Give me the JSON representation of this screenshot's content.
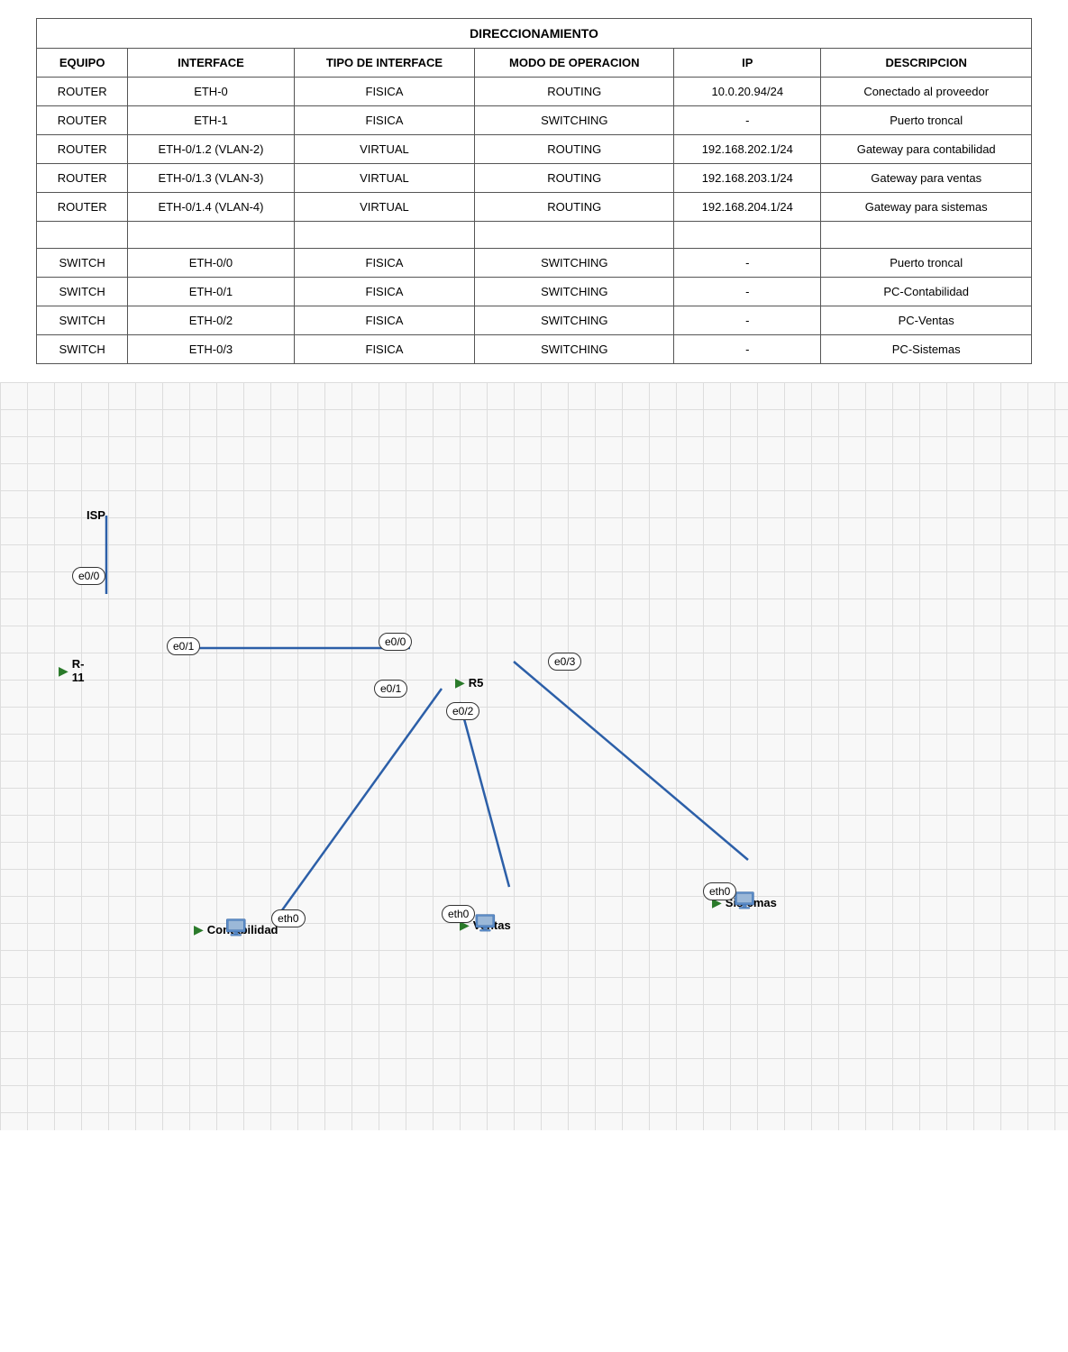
{
  "table": {
    "title": "DIRECCIONAMIENTO",
    "headers": [
      "EQUIPO",
      "INTERFACE",
      "TIPO DE INTERFACE",
      "MODO DE OPERACION",
      "IP",
      "DESCRIPCION"
    ],
    "rows": [
      [
        "ROUTER",
        "ETH-0",
        "FISICA",
        "ROUTING",
        "10.0.20.94/24",
        "Conectado al proveedor"
      ],
      [
        "ROUTER",
        "ETH-1",
        "FISICA",
        "SWITCHING",
        "-",
        "Puerto troncal"
      ],
      [
        "ROUTER",
        "ETH-0/1.2 (VLAN-2)",
        "VIRTUAL",
        "ROUTING",
        "192.168.202.1/24",
        "Gateway para contabilidad"
      ],
      [
        "ROUTER",
        "ETH-0/1.3 (VLAN-3)",
        "VIRTUAL",
        "ROUTING",
        "192.168.203.1/24",
        "Gateway para ventas"
      ],
      [
        "ROUTER",
        "ETH-0/1.4 (VLAN-4)",
        "VIRTUAL",
        "ROUTING",
        "192.168.204.1/24",
        "Gateway para sistemas"
      ],
      [
        "",
        "",
        "",
        "",
        "",
        ""
      ],
      [
        "SWITCH",
        "ETH-0/0",
        "FISICA",
        "SWITCHING",
        "-",
        "Puerto troncal"
      ],
      [
        "SWITCH",
        "ETH-0/1",
        "FISICA",
        "SWITCHING",
        "-",
        "PC-Contabilidad"
      ],
      [
        "SWITCH",
        "ETH-0/2",
        "FISICA",
        "SWITCHING",
        "-",
        "PC-Ventas"
      ],
      [
        "SWITCH",
        "ETH-0/3",
        "FISICA",
        "SWITCHING",
        "-",
        "PC-Sistemas"
      ]
    ]
  },
  "diagram": {
    "isp_label": "ISP",
    "r11_label": "R-11",
    "r5_label": "R5",
    "contabilidad_label": "Contabilidad",
    "ventas_label": "Ventas",
    "sistemas_label": "Sistemas",
    "ports": {
      "r11_e00": "e0/0",
      "r11_e01": "e0/1",
      "r5_e00": "e0/0",
      "r5_e01": "e0/1",
      "r5_e02": "e0/2",
      "r5_e03": "e0/3",
      "cont_eth0": "eth0",
      "ven_eth0": "eth0",
      "sis_eth0": "eth0"
    }
  }
}
